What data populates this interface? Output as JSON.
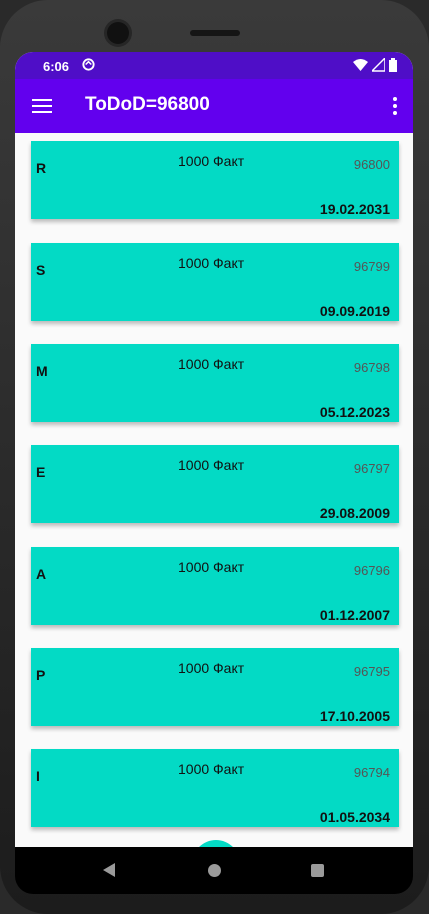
{
  "status_bar": {
    "time": "6:06"
  },
  "app_bar": {
    "title": "ToDoD=96800"
  },
  "items": [
    {
      "letter": "R",
      "title": "1000 Факт",
      "id": "96800",
      "date": "19.02.2031"
    },
    {
      "letter": "S",
      "title": "1000 Факт",
      "id": "96799",
      "date": "09.09.2019"
    },
    {
      "letter": "M",
      "title": "1000 Факт",
      "id": "96798",
      "date": "05.12.2023"
    },
    {
      "letter": "E",
      "title": "1000 Факт",
      "id": "96797",
      "date": "29.08.2009"
    },
    {
      "letter": "A",
      "title": "1000 Факт",
      "id": "96796",
      "date": "01.12.2007"
    },
    {
      "letter": "P",
      "title": "1000 Факт",
      "id": "96795",
      "date": "17.10.2005"
    },
    {
      "letter": "I",
      "title": "1000 Факт",
      "id": "96794",
      "date": "01.05.2034"
    }
  ],
  "icons": {
    "status": [
      "sync-icon",
      "wifi-icon",
      "signal-icon",
      "battery-icon"
    ],
    "app_bar": [
      "menu-icon",
      "more-vert-icon"
    ],
    "nav": [
      "back-icon",
      "home-icon",
      "recents-icon"
    ]
  },
  "colors": {
    "status_bar": "#4f0ec7",
    "app_bar": "#6200ee",
    "card": "#03dac5",
    "fab": "#03dac5"
  }
}
